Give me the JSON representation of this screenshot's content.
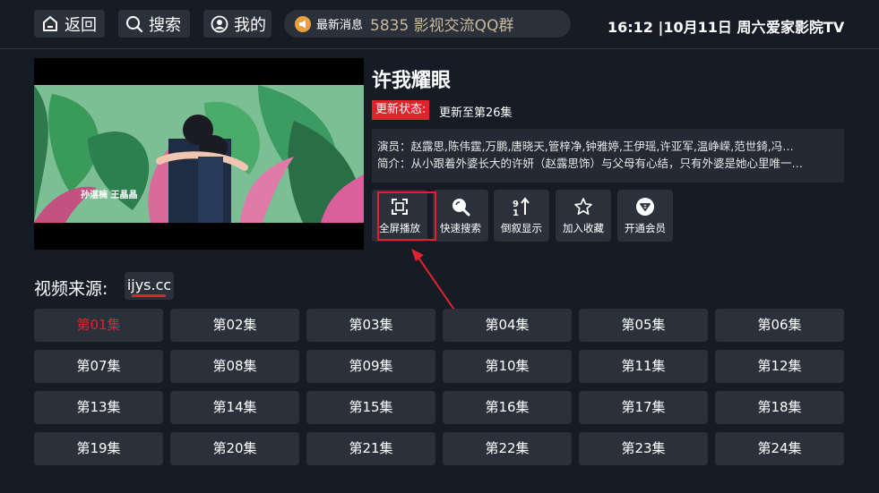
{
  "topbar": {
    "back_label": "返回",
    "search_label": "搜索",
    "mine_label": "我的",
    "news_label": "最新消息",
    "news_text": "5835        影视交流QQ群",
    "clock": "16:12 |10月11日 周六",
    "brand": "爱家影院TV"
  },
  "detail": {
    "title": "许我耀眼",
    "status_tag": "更新状态:",
    "status_value": "更新至第26集",
    "cast": "演员：赵露思,陈伟霆,万鹏,唐晓天,管梓净,钟雅婷,王伊瑶,许亚军,温峥嵘,范世錡,冯…",
    "synopsis": "简介：从小跟着外婆长大的许妍（赵露思饰）与父母有心结，只有外婆是她心里唯一…",
    "subtitle_text": "孙湛楠  王晶晶"
  },
  "actions": [
    {
      "label": "全屏播放",
      "icon": "fullscreen-icon"
    },
    {
      "label": "快速搜索",
      "icon": "search-icon"
    },
    {
      "label": "倒叙显示",
      "icon": "sort-icon"
    },
    {
      "label": "加入收藏",
      "icon": "star-icon"
    },
    {
      "label": "开通会员",
      "icon": "vip-icon"
    }
  ],
  "source": {
    "label": "视频来源:",
    "current": "ijys.cc"
  },
  "episodes": [
    "第01集",
    "第02集",
    "第03集",
    "第04集",
    "第05集",
    "第06集",
    "第07集",
    "第08集",
    "第09集",
    "第10集",
    "第11集",
    "第12集",
    "第13集",
    "第14集",
    "第15集",
    "第16集",
    "第17集",
    "第18集",
    "第19集",
    "第20集",
    "第21集",
    "第22集",
    "第23集",
    "第24集"
  ],
  "active_episode": "第01集",
  "colors": {
    "accent": "#e0232b",
    "background": "#151c25",
    "button": "#2b313a"
  }
}
